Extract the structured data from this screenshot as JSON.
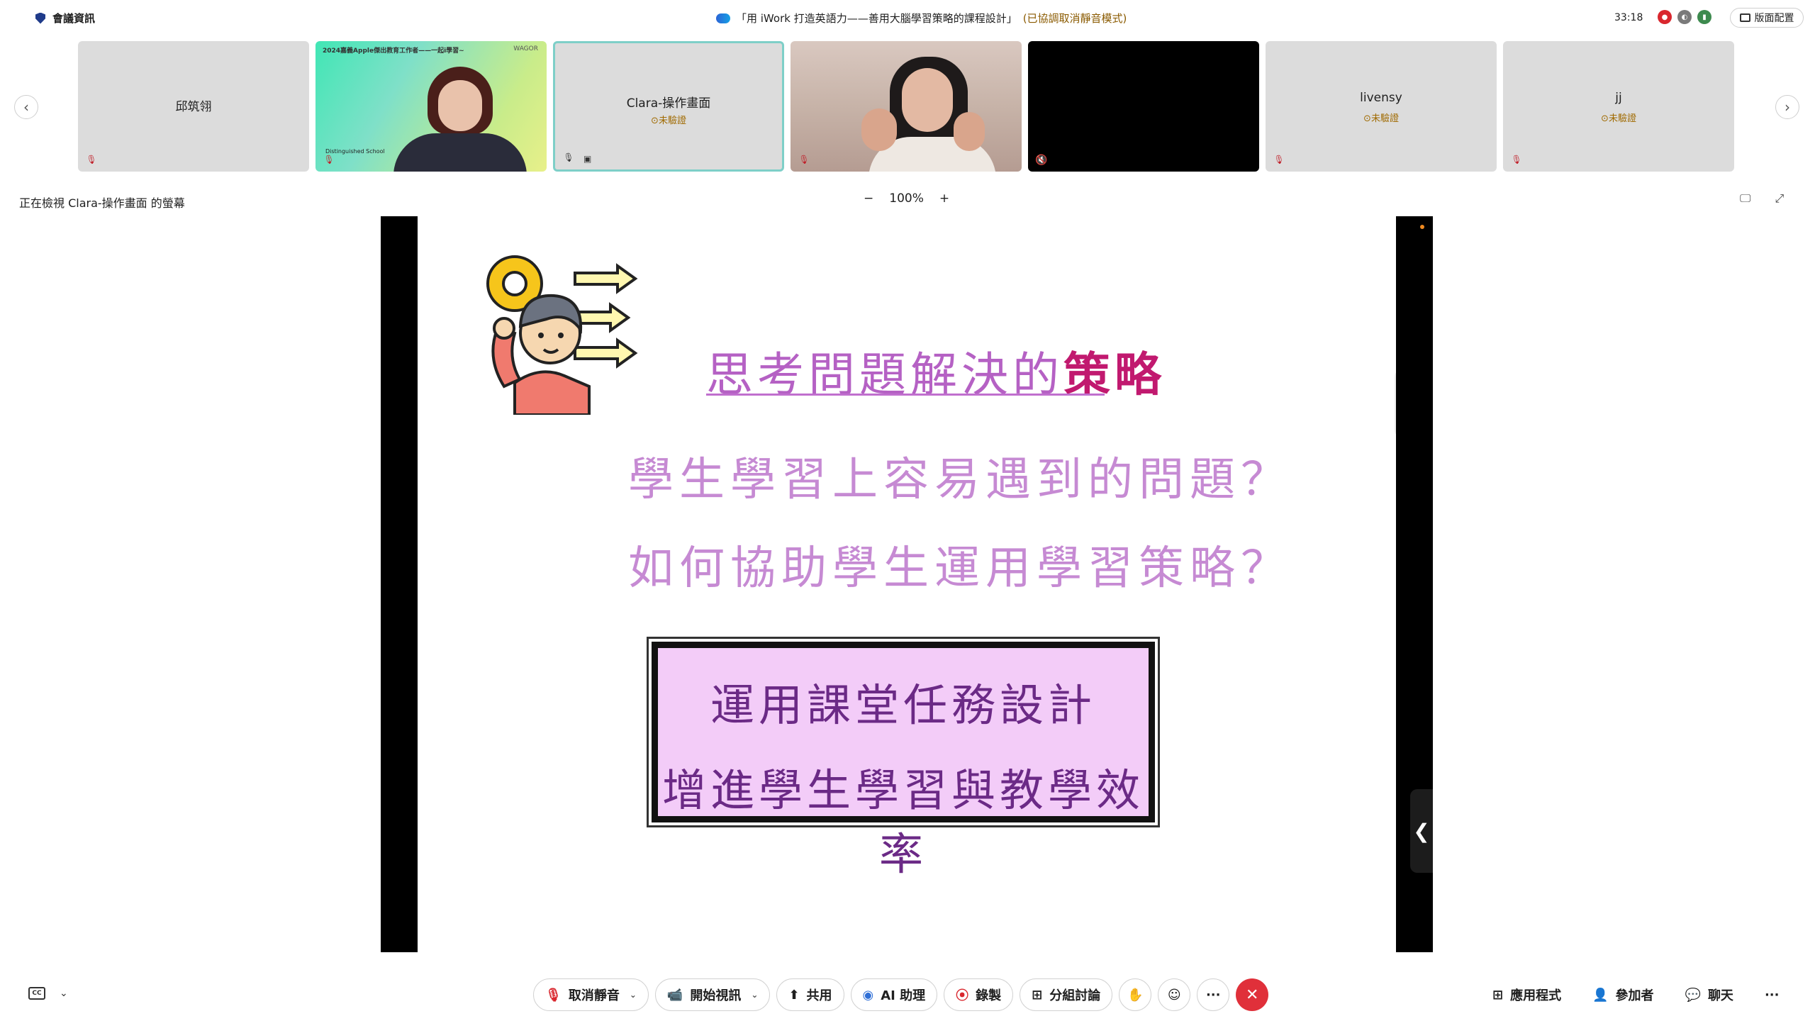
{
  "titlebar": {
    "meeting_info": "會議資訊",
    "window_title": "「用 iWork 打造英語力——善用大腦學習策略的課程設計」",
    "title_tag": "(已協調取消靜音模式)",
    "timer": "33:18",
    "layout_label": "版面配置"
  },
  "participants": [
    {
      "name": "邱筑翎",
      "verify": ""
    },
    {
      "name": "",
      "banner": "2024嘉義Apple傑出教育工作者——一起i學習~",
      "logo": "WAGOR",
      "school": "Distinguished School"
    },
    {
      "name": "Clara-操作畫面",
      "verify": "⊙未驗證"
    },
    {
      "name": ""
    },
    {
      "name": ""
    },
    {
      "name": "livensy",
      "verify": "⊙未驗證"
    },
    {
      "name": "jj",
      "verify": "⊙未驗證"
    }
  ],
  "share": {
    "viewing_label": "正在檢視 Clara-操作畫面 的螢幕",
    "zoom_out": "−",
    "zoom_level": "100%",
    "zoom_in": "+"
  },
  "slide": {
    "title_main": "思考問題解決的",
    "title_accent": "策略",
    "question1": "學生學習上容易遇到的問題？",
    "question2": "如何協助學生運用學習策略？",
    "box_line1": "運用課堂任務設計",
    "box_line2": "增進學生學習與教學效率"
  },
  "toolbar": {
    "cc_label": "CC",
    "unmute": "取消靜音",
    "start_video": "開始視訊",
    "share": "共用",
    "ai_assistant": "AI 助理",
    "record": "錄製",
    "breakout": "分組討論",
    "more": "···",
    "end": "✕"
  },
  "right_tools": {
    "apps": "應用程式",
    "participants": "參加者",
    "chat": "聊天",
    "more": "···"
  },
  "colors": {
    "accent_red": "#d9272e",
    "slide_purple": "#b561c4",
    "slide_pink_box": "#f3ccf8",
    "active_tile_border": "#7ecfc8"
  }
}
